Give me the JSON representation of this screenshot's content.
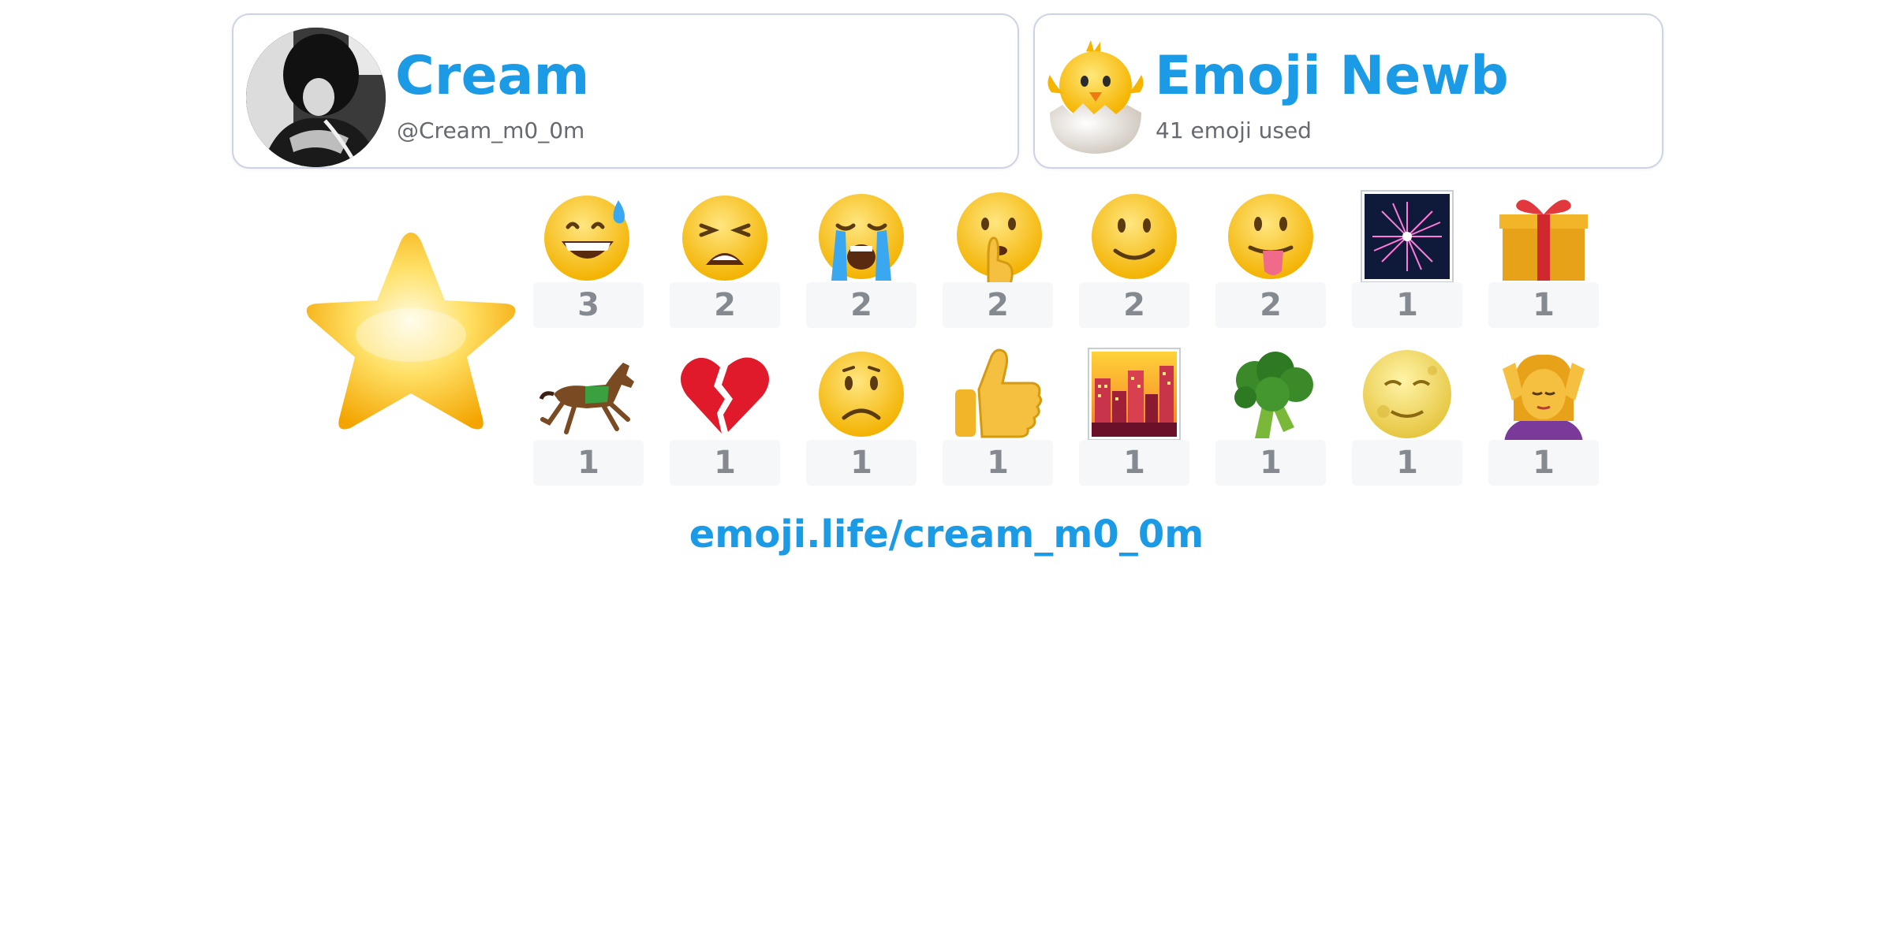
{
  "user": {
    "name": "Cream",
    "handle": "@Cream_m0_0m"
  },
  "rank": {
    "title": "Emoji Newb",
    "subtitle": "41 emoji used",
    "icon": "hatching-chick-icon"
  },
  "badge_icon": "star-icon",
  "emoji_stats": [
    {
      "icon": "grinning-sweat-face-icon",
      "count": "3"
    },
    {
      "icon": "weary-face-icon",
      "count": "2"
    },
    {
      "icon": "loudly-crying-face-icon",
      "count": "2"
    },
    {
      "icon": "shushing-face-icon",
      "count": "2"
    },
    {
      "icon": "slightly-smiling-face-icon",
      "count": "2"
    },
    {
      "icon": "face-with-tongue-icon",
      "count": "2"
    },
    {
      "icon": "fireworks-icon",
      "count": "1"
    },
    {
      "icon": "wrapped-gift-icon",
      "count": "1"
    },
    {
      "icon": "horse-racing-icon",
      "count": "1"
    },
    {
      "icon": "broken-heart-icon",
      "count": "1"
    },
    {
      "icon": "frowning-face-icon",
      "count": "1"
    },
    {
      "icon": "thumbs-up-icon",
      "count": "1"
    },
    {
      "icon": "city-at-dusk-icon",
      "count": "1"
    },
    {
      "icon": "broccoli-icon",
      "count": "1"
    },
    {
      "icon": "full-moon-face-icon",
      "count": "1"
    },
    {
      "icon": "person-getting-massage-icon",
      "count": "1"
    }
  ],
  "profile_link": "emoji.life/cream_m0_0m",
  "colors": {
    "accent": "#1b9be6",
    "card_border": "#ccd3e6",
    "count_bg": "#f6f7f9",
    "count_text": "#858a90",
    "subtitle_text": "#666a70"
  }
}
